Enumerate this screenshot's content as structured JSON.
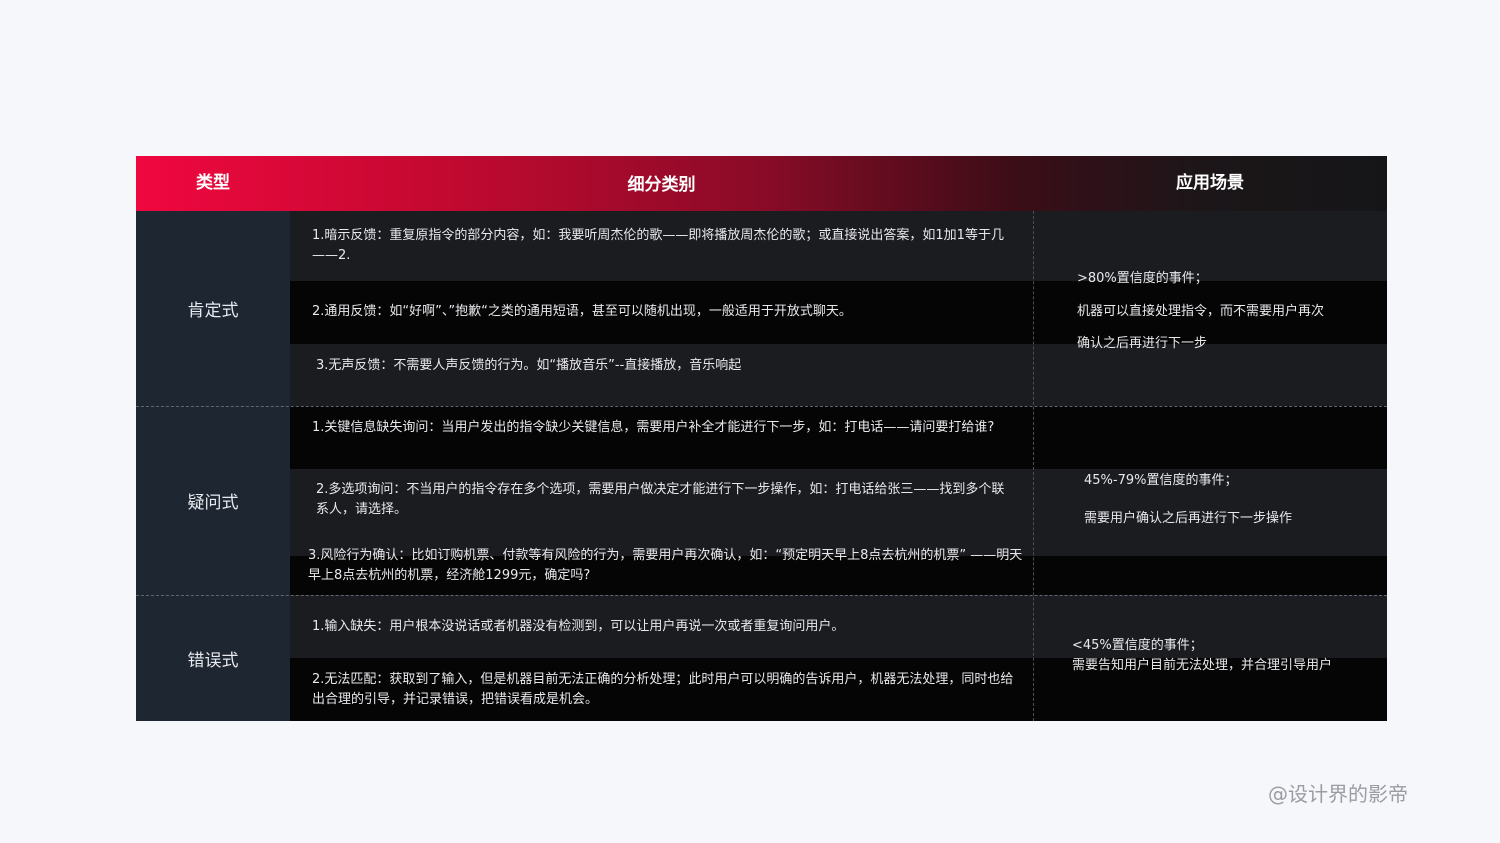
{
  "header": {
    "col_type": "类型",
    "col_sub": "细分类别",
    "col_scene": "应用场景"
  },
  "rows": [
    {
      "category": "肯定式",
      "items": [
        "1.暗示反馈：重复原指令的部分内容，如：我要听周杰伦的歌——即将播放周杰伦的歌；或直接说出答案，如1加1等于几——2.",
        "2.通用反馈：如“好啊”、”抱歉“之类的通用短语，甚至可以随机出现，一般适用于开放式聊天。",
        "3.无声反馈：不需要人声反馈的行为。如“播放音乐”--直接播放，音乐响起"
      ],
      "scene": [
        ">80%置信度的事件；",
        "机器可以直接处理指令，而不需要用户再次",
        "确认之后再进行下一步"
      ]
    },
    {
      "category": "疑问式",
      "items": [
        "1.关键信息缺失询问：当用户发出的指令缺少关键信息，需要用户补全才能进行下一步，如：打电话——请问要打给谁?",
        "2.多选项询问：不当用户的指令存在多个选项，需要用户做决定才能进行下一步操作，如：打电话给张三——找到多个联系人，请选择。",
        "3.风险行为确认：比如订购机票、付款等有风险的行为，需要用户再次确认，如：“预定明天早上8点去杭州的机票” ——明天早上8点去杭州的机票，经济舱1299元，确定吗?"
      ],
      "scene": [
        "45%-79%置信度的事件；",
        "需要用户确认之后再进行下一步操作"
      ]
    },
    {
      "category": "错误式",
      "items": [
        "1.输入缺失：用户根本没说话或者机器没有检测到，可以让用户再说一次或者重复询问用户。",
        "2.无法匹配：获取到了输入，但是机器目前无法正确的分析处理；此时用户可以明确的告诉用户，机器无法处理，同时也给出合理的引导，并记录错误，把错误看成是机会。"
      ],
      "scene": [
        "<45%置信度的事件；",
        "需要告知用户目前无法处理，并合理引导用户"
      ]
    }
  ],
  "watermark": "@设计界的影帝"
}
